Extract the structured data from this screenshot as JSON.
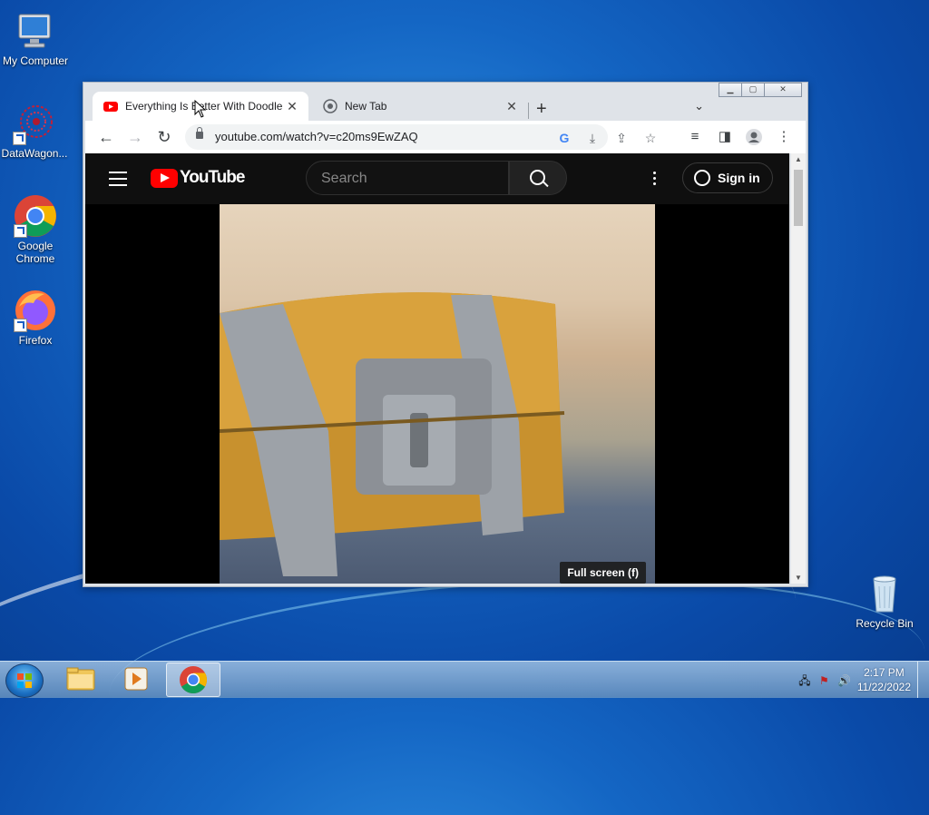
{
  "desktop": {
    "icons": [
      {
        "label": "My Computer"
      },
      {
        "label": "DataWagon..."
      },
      {
        "label": "Google Chrome"
      },
      {
        "label": "Firefox"
      },
      {
        "label": "Recycle Bin"
      }
    ]
  },
  "browser": {
    "tabs": [
      {
        "title": "Everything Is Better With Doodle",
        "active": true
      },
      {
        "title": "New Tab",
        "active": false
      }
    ],
    "new_tab_symbol": "+",
    "url": "youtube.com/watch?v=c20ms9EwZAQ"
  },
  "youtube": {
    "logo_text": "YouTube",
    "search_placeholder": "Search",
    "sign_in": "Sign in",
    "fullscreen_tooltip": "Full screen (f)"
  },
  "taskbar": {
    "time": "2:17 PM",
    "date": "11/22/2022"
  },
  "colors": {
    "youtube_red": "#ff0000",
    "yt_header": "#0f0f0f",
    "chrome_toolbar": "#ffffff"
  }
}
